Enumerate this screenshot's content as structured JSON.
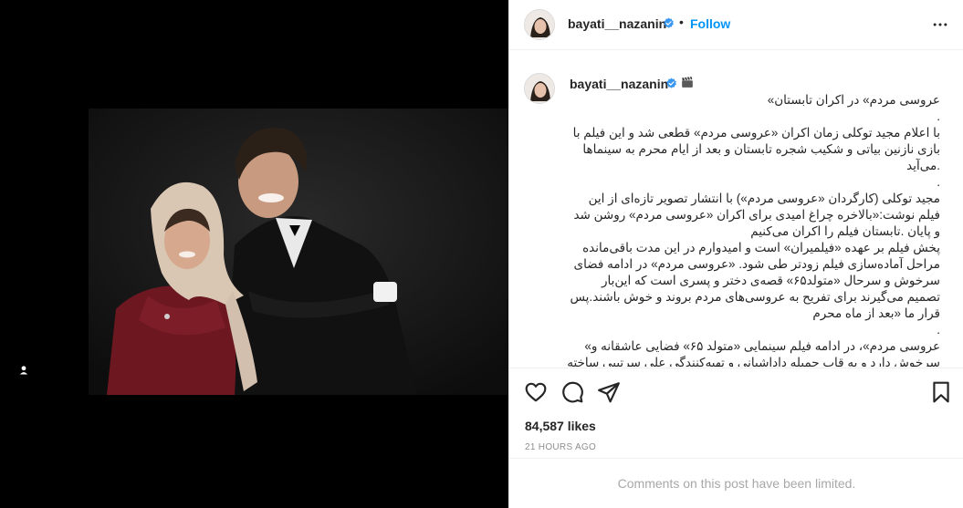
{
  "post": {
    "username": "bayati__nazanin",
    "follow_label": "Follow",
    "separator": "•",
    "caption_lines": [
      "عروسی مردم» در اکران تابستان»",
      ".",
      "با اعلام مجید توکلی زمان اکران «عروسی مردم» قطعی شد و این فیلم با بازی نازنین بیاتی و شکیب شجره تابستان و بعد از ایام محرم به سینماها .می‌آید",
      ".",
      "مجید توکلی (کارگردان «عروسی مردم») با انتشار تصویر تازه‌ای از این فیلم نوشت:«بالاخره چراغ امیدی برای اکران «عروسی مردم» روشن شد و پایان .تابستان فیلم را اکران می‌کنیم",
      "پخش فیلم بر عهده «فیلمیران» است و امیدوارم در این مدت باقی‌مانده مراحل آماده‌سازی فیلم زودتر طی شود. «عروسی مردم» در ادامه فضای سرخوش و سرحال «متولد۶۵» قصه‌ی دختر و پسری است که این‌بار تصمیم می‌گیرند برای تفریح به عروسی‌های مردم بروند و خوش باشند.پس قرار ما «بعد از ماه محرم",
      ".",
      "عروسی مردم»، در ادامه فیلم سینمایی «متولد ۶۵» فضایی عاشقانه و» سرخوش دارد و به قاب جمیله داداشیانی و تهیه‌کنندگی علی سرتیپی ساخته"
    ],
    "likes": "84,587 likes",
    "time": "21 HOURS AGO",
    "comments_notice": "Comments on this post have been limited."
  },
  "colors": {
    "accent": "#0095f6",
    "verified": "#3897f0",
    "muted": "#8e8e8e",
    "border": "#efefef"
  },
  "icons": [
    "more-options-icon",
    "verified-badge-icon",
    "clapperboard-icon",
    "heart-icon",
    "comment-icon",
    "share-icon",
    "bookmark-icon",
    "tagged-user-icon"
  ]
}
